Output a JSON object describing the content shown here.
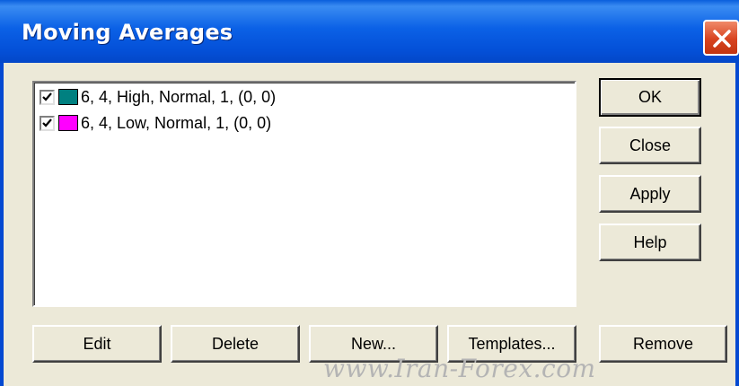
{
  "window": {
    "title": "Moving Averages"
  },
  "list": {
    "items": [
      {
        "checked": true,
        "color": "#008080",
        "label": "6, 4, High, Normal, 1, (0, 0)"
      },
      {
        "checked": true,
        "color": "#ff00ff",
        "label": "6, 4, Low, Normal, 1, (0, 0)"
      }
    ]
  },
  "buttons": {
    "ok": "OK",
    "close": "Close",
    "apply": "Apply",
    "help": "Help",
    "edit": "Edit",
    "delete": "Delete",
    "new": "New...",
    "templates": "Templates...",
    "remove": "Remove"
  },
  "watermark": "www.Iran-Forex.com"
}
